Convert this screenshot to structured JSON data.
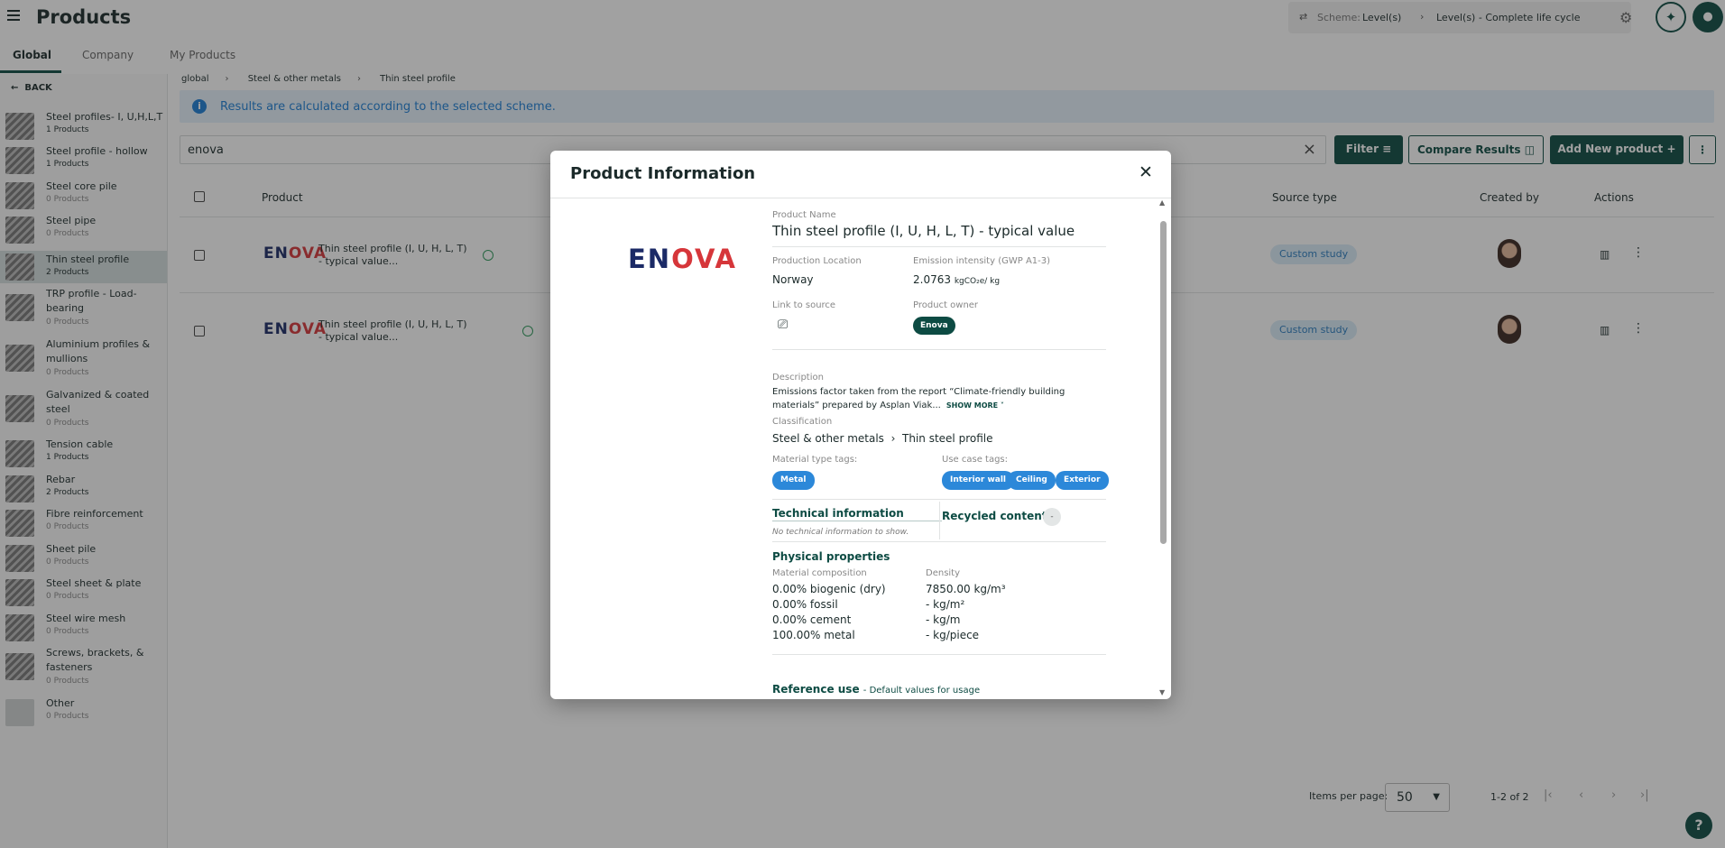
{
  "header": {
    "title": "Products",
    "scheme_label": "Scheme:",
    "scheme_value": "Level(s)",
    "scheme_full": "Level(s) - Complete life cycle"
  },
  "tabs": [
    "Global",
    "Company",
    "My Products"
  ],
  "sidebar": {
    "back_label": "BACK",
    "categories": [
      {
        "name": "Steel profiles- I, U,H,L,T",
        "count": "1 Products"
      },
      {
        "name": "Steel profile - hollow",
        "count": "1 Products"
      },
      {
        "name": "Steel core pile",
        "count": "0 Products"
      },
      {
        "name": "Steel pipe",
        "count": "0 Products"
      },
      {
        "name": "Thin steel profile",
        "count": "2 Products"
      },
      {
        "name": "TRP profile - Load-bearing",
        "count": "0 Products"
      },
      {
        "name": "Aluminium profiles & mullions",
        "count": "0 Products"
      },
      {
        "name": "Galvanized & coated steel",
        "count": "0 Products"
      },
      {
        "name": "Tension cable",
        "count": "1 Products"
      },
      {
        "name": "Rebar",
        "count": "2 Products"
      },
      {
        "name": "Fibre reinforcement",
        "count": "0 Products"
      },
      {
        "name": "Sheet pile",
        "count": "0 Products"
      },
      {
        "name": "Steel sheet & plate",
        "count": "0 Products"
      },
      {
        "name": "Steel wire mesh",
        "count": "0 Products"
      },
      {
        "name": "Screws, brackets, & fasteners",
        "count": "0 Products"
      },
      {
        "name": "Other",
        "count": "0 Products"
      }
    ]
  },
  "breadcrumb": [
    "global",
    "Steel & other metals",
    "Thin steel profile"
  ],
  "info_bar": {
    "text": "Results are calculated according to the selected scheme."
  },
  "search": {
    "value": "enova"
  },
  "toolbar": {
    "filter_label": "Filter",
    "compare_label": "Compare Results",
    "add_label": "Add New product"
  },
  "table": {
    "headers": {
      "product": "Product",
      "source_type": "Source type",
      "created_by": "Created by",
      "actions": "Actions"
    },
    "rows": [
      {
        "logo": "ENOVA",
        "name": "Thin steel profile (I, U, H, L, T) - typical value...",
        "source_type": "Custom study"
      },
      {
        "logo": "ENOVA",
        "name": "Thin steel profile (I, U, H, L, T) - typical value...",
        "source_type": "Custom study"
      }
    ]
  },
  "pagination": {
    "items_per_page_label": "Items per page:",
    "items_per_page": "50",
    "range": "1-2 of 2"
  },
  "modal": {
    "title": "Product Information",
    "logo": {
      "main": "EN",
      "accent": "OVA"
    },
    "product_name_label": "Product Name",
    "product_name": "Thin steel profile (I, U, H, L, T) - typical value",
    "production_location_label": "Production Location",
    "production_location": "Norway",
    "emission_label": "Emission intensity (GWP A1-3)",
    "emission_value": "2.0763",
    "emission_unit": "kgCO₂e/ kg",
    "link_label": "Link to source",
    "owner_label": "Product owner",
    "owner": "Enova",
    "description_label": "Description",
    "description": "Emissions factor taken from the report “Climate-friendly building materials” prepared by Asplan Viak...",
    "show_more": "SHOW MORE ˅",
    "classification_label": "Classification",
    "classification": [
      "Steel & other metals",
      "Thin steel profile"
    ],
    "material_tags_label": "Material type tags:",
    "material_tags": [
      "Metal"
    ],
    "use_case_tags_label": "Use case tags:",
    "use_case_tags": [
      "Interior wall",
      "Ceiling",
      "Exterior"
    ],
    "technical_info_title": "Technical information",
    "technical_info_empty": "No technical information to show.",
    "recycled_label": "Recycled content:",
    "recycled_value": "-",
    "physical_title": "Physical properties",
    "composition_label": "Material composition",
    "composition": [
      "0.00% biogenic (dry)",
      "0.00% fossil",
      "0.00% cement",
      "100.00% metal"
    ],
    "density_label": "Density",
    "density": [
      "7850.00 kg/m³",
      "- kg/m²",
      "- kg/m",
      "- kg/piece"
    ],
    "reference_use_title": "Reference use",
    "reference_use_sub": "- Default values for usage"
  },
  "colors": {
    "brand": "#0d4b43",
    "info": "#1c7ed6",
    "tag": "#2c88d9",
    "logo_navy": "#1b2a66",
    "logo_red": "#d6363a"
  }
}
